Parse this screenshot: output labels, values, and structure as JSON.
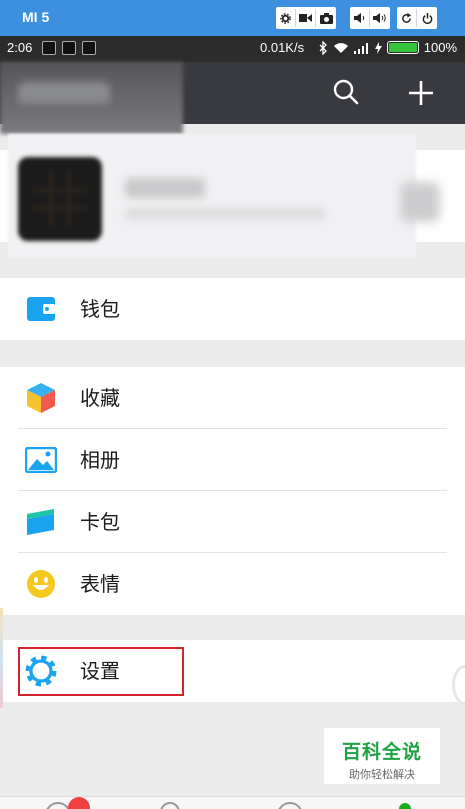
{
  "frame": {
    "title": "MI 5",
    "buttons": [
      "settings-icon",
      "video-icon",
      "camera-icon",
      "volume-down-icon",
      "volume-up-icon",
      "rotate-icon",
      "power-icon"
    ]
  },
  "status_bar": {
    "time": "2:06",
    "net_speed": "0.01K/s",
    "battery_level": "100%",
    "battery_fraction": 1.0
  },
  "header": {
    "actions": [
      "search-icon",
      "add-icon"
    ]
  },
  "menu": {
    "wallet": "钱包",
    "favorites": "收藏",
    "album": "相册",
    "cards": "卡包",
    "stickers": "表情",
    "settings": "设置"
  },
  "watermark": {
    "title": "百科全说",
    "subtitle": "助你轻松解决"
  },
  "colors": {
    "header_bg": "#393a3f",
    "frame_bg": "#3d8fe0",
    "icon_blue": "#1aa3f0",
    "highlight": "#d3232b",
    "watermark_green": "#1fa244"
  }
}
